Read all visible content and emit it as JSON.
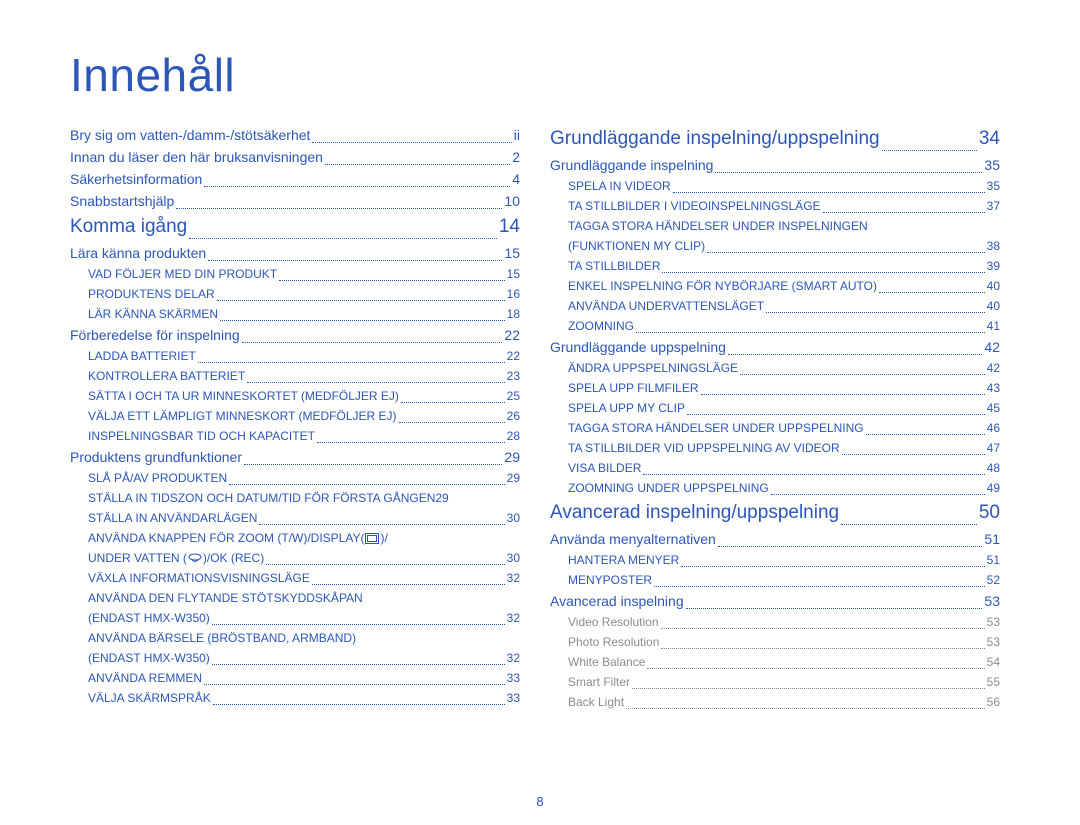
{
  "pageTitle": "Innehåll",
  "pageNumber": "8",
  "leftColumn": [
    {
      "level": "l1",
      "label": "Bry sig om vatten-/damm-/stötsäkerhet",
      "page": "ii"
    },
    {
      "level": "l1",
      "label": "Innan du läser den här bruksanvisningen",
      "page": "2"
    },
    {
      "level": "l1",
      "label": "Säkerhetsinformation",
      "page": "4"
    },
    {
      "level": "l1",
      "label": "Snabbstartshjälp",
      "page": "10"
    },
    {
      "level": "l1 section",
      "label": "Komma igång",
      "page": "14"
    },
    {
      "level": "l2",
      "label": "Lära känna produkten",
      "page": "15"
    },
    {
      "level": "l3",
      "label": "VAD FÖLJER MED DIN PRODUKT",
      "page": "15"
    },
    {
      "level": "l3",
      "label": "PRODUKTENS DELAR",
      "page": "16"
    },
    {
      "level": "l3",
      "label": "LÄR KÄNNA SKÄRMEN",
      "page": "18"
    },
    {
      "level": "l2",
      "label": "Förberedelse för inspelning",
      "page": "22"
    },
    {
      "level": "l3",
      "label": "LADDA BATTERIET",
      "page": "22"
    },
    {
      "level": "l3",
      "label": "KONTROLLERA BATTERIET",
      "page": "23"
    },
    {
      "level": "l3",
      "label": "SÄTTA I OCH TA UR MINNESKORTET (MEDFÖLJER EJ)",
      "page": "25"
    },
    {
      "level": "l3",
      "label": "VÄLJA ETT LÄMPLIGT MINNESKORT (MEDFÖLJER EJ)",
      "page": "26"
    },
    {
      "level": "l3",
      "label": "INSPELNINGSBAR TID OCH KAPACITET",
      "page": "28"
    },
    {
      "level": "l2",
      "label": "Produktens grundfunktioner",
      "page": "29"
    },
    {
      "level": "l3",
      "label": "SLÅ PÅ/AV PRODUKTEN",
      "page": "29"
    },
    {
      "level": "l3",
      "label": "STÄLLA IN TIDSZON OCH DATUM/TID FÖR FÖRSTA GÅNGEN",
      "page": "29",
      "tight": true
    },
    {
      "level": "l3",
      "label": "STÄLLA IN ANVÄNDARLÄGEN",
      "page": "30"
    },
    {
      "level": "l3",
      "icons": true,
      "labelA": "ANVÄNDA KNAPPEN FÖR ZOOM (T/W)/DISPLAY(",
      "labelB": ")/",
      "labelC": "UNDER VATTEN (",
      "labelD": ")/OK (REC)",
      "page": "30"
    },
    {
      "level": "l3",
      "label": "VÄXLA INFORMATIONSVISNINGSLÄGE",
      "page": "32"
    },
    {
      "level": "l3",
      "twoLine": true,
      "labelA": "ANVÄNDA DEN FLYTANDE STÖTSKYDDSKÅPAN",
      "labelB": "(ENDAST HMX-W350)",
      "page": "32"
    },
    {
      "level": "l3",
      "twoLine": true,
      "labelA": "ANVÄNDA BÄRSELE (BRÖSTBAND, ARMBAND)",
      "labelB": "(ENDAST HMX-W350)",
      "page": "32"
    },
    {
      "level": "l3",
      "label": "ANVÄNDA REMMEN",
      "page": "33"
    },
    {
      "level": "l3",
      "label": "VÄLJA SKÄRMSPRÅK",
      "page": "33"
    }
  ],
  "rightColumn": [
    {
      "level": "l1 section",
      "label": "Grundläggande inspelning/uppspelning",
      "page": "34"
    },
    {
      "level": "l2",
      "label": "Grundläggande inspelning",
      "page": "35"
    },
    {
      "level": "l3",
      "label": "SPELA IN VIDEOR",
      "page": "35"
    },
    {
      "level": "l3",
      "label": "TA STILLBILDER I VIDEOINSPELNINGSLÄGE",
      "page": "37"
    },
    {
      "level": "l3",
      "twoLine": true,
      "labelA": "TAGGA STORA HÄNDELSER UNDER INSPELNINGEN",
      "labelB": "(FUNKTIONEN MY CLIP)",
      "page": "38"
    },
    {
      "level": "l3",
      "label": "TA STILLBILDER",
      "page": "39"
    },
    {
      "level": "l3",
      "label": "ENKEL INSPELNING FÖR NYBÖRJARE (SMART AUTO)",
      "page": "40"
    },
    {
      "level": "l3",
      "label": "ANVÄNDA UNDERVATTENSLÄGET",
      "page": "40"
    },
    {
      "level": "l3",
      "label": "ZOOMNING",
      "page": "41"
    },
    {
      "level": "l2",
      "label": "Grundläggande uppspelning",
      "page": "42"
    },
    {
      "level": "l3",
      "label": "ÄNDRA UPPSPELNINGSLÄGE",
      "page": "42"
    },
    {
      "level": "l3",
      "label": "SPELA UPP FILMFILER",
      "page": "43"
    },
    {
      "level": "l3",
      "label": "SPELA UPP MY CLIP",
      "page": "45"
    },
    {
      "level": "l3",
      "label": "TAGGA STORA HÄNDELSER UNDER UPPSPELNING",
      "page": "46"
    },
    {
      "level": "l3",
      "label": "TA STILLBILDER VID UPPSPELNING AV VIDEOR",
      "page": "47"
    },
    {
      "level": "l3",
      "label": "VISA BILDER",
      "page": "48"
    },
    {
      "level": "l3",
      "label": "ZOOMNING UNDER UPPSPELNING",
      "page": "49"
    },
    {
      "level": "l1 section",
      "label": "Avancerad inspelning/uppspelning",
      "page": "50"
    },
    {
      "level": "l2",
      "label": "Använda menyalternativen",
      "page": "51"
    },
    {
      "level": "l3",
      "label": "HANTERA MENYER",
      "page": "51"
    },
    {
      "level": "l3",
      "label": "MENYPOSTER",
      "page": "52"
    },
    {
      "level": "l2",
      "label": "Avancerad inspelning",
      "page": "53"
    },
    {
      "level": "l3 gray",
      "label": "Video Resolution",
      "page": "53"
    },
    {
      "level": "l3 gray",
      "label": "Photo Resolution",
      "page": "53"
    },
    {
      "level": "l3 gray",
      "label": "White Balance",
      "page": "54"
    },
    {
      "level": "l3 gray",
      "label": "Smart Filter",
      "page": "55"
    },
    {
      "level": "l3 gray",
      "label": "Back Light",
      "page": "56"
    }
  ]
}
